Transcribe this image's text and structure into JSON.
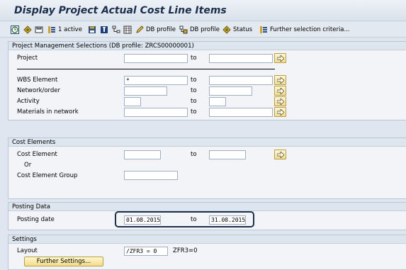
{
  "window": {
    "title": "Display Project Actual Cost Line Items"
  },
  "toolbar": {
    "active_label": "1 active",
    "db_profile_1": "DB profile",
    "db_profile_2": "DB profile",
    "status": "Status",
    "further_selection": "Further selection criteria..."
  },
  "pm": {
    "heading": "Project Management Selections (DB profile: ZRCS00000001)",
    "project": {
      "label": "Project",
      "from": "",
      "to": ""
    },
    "wbs": {
      "label": "WBS Element",
      "from": "*",
      "to": ""
    },
    "network": {
      "label": "Network/order",
      "from": "",
      "to": ""
    },
    "activity": {
      "label": "Activity",
      "from": "",
      "to": ""
    },
    "materials": {
      "label": "Materials in network",
      "from": "",
      "to": ""
    }
  },
  "ce": {
    "heading": "Cost Elements",
    "cost_element": {
      "label": "Cost Element",
      "from": "",
      "to": ""
    },
    "or_label": "Or",
    "group": {
      "label": "Cost Element Group",
      "value": ""
    }
  },
  "posting": {
    "heading": "Posting Data",
    "date": {
      "label": "Posting date",
      "from": "01.08.2015",
      "to": "31.08.2015"
    }
  },
  "settings": {
    "heading": "Settings",
    "layout": {
      "label": "Layout",
      "value": "/ZFR3 = 0",
      "description": "ZFR3=0"
    },
    "further_btn": "Further Settings..."
  },
  "to_label": "to"
}
